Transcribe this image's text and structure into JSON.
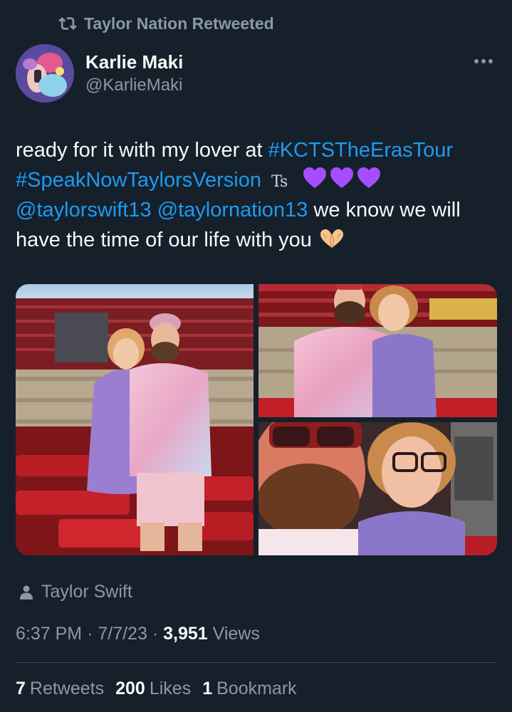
{
  "retweet_header": {
    "label": "Taylor Nation Retweeted"
  },
  "author": {
    "name": "Karlie Maki",
    "handle": "@KarlieMaki"
  },
  "tweet": {
    "text_1": "ready for it with my lover at ",
    "hashtag_1": "#KCTSTheErasTour",
    "hashtag_2": "#SpeakNowTaylorsVersion",
    "ts_emoji": "Ts",
    "mention_1": "@taylorswift13",
    "mention_2": "@taylornation13",
    "text_2": " we know we will",
    "text_3": "have the time of our life with you"
  },
  "tagged": {
    "label": "Taylor Swift"
  },
  "meta": {
    "time": "6:37 PM",
    "date": "7/7/23",
    "views_count": "3,951",
    "views_label": "Views"
  },
  "stats": {
    "retweets_count": "7",
    "retweets_label": "Retweets",
    "likes_count": "200",
    "likes_label": "Likes",
    "bookmarks_count": "1",
    "bookmarks_label": "Bookmark"
  },
  "colors": {
    "background": "#15202b",
    "link": "#1d9bf0",
    "secondary_text": "#8b98a5",
    "heart": "#a64dff"
  },
  "icons": [
    "retweet-icon",
    "more-options-icon",
    "purple-heart-icon",
    "heart-hands-icon",
    "person-icon"
  ]
}
